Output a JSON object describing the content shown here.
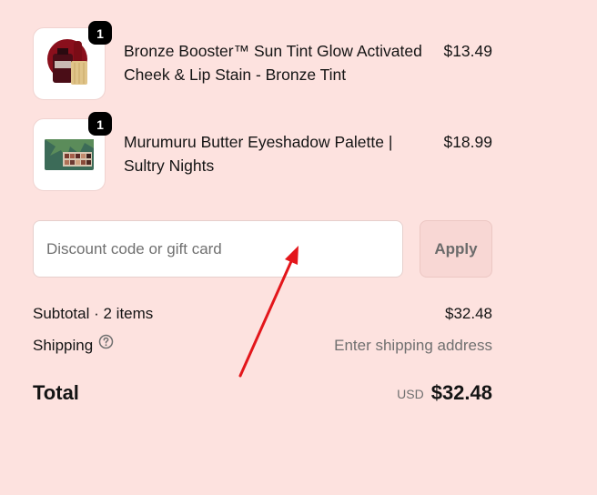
{
  "line_items": [
    {
      "name": "Bronze Booster™ Sun Tint Glow Activated Cheek & Lip Stain - Bronze Tint",
      "price": "$13.49",
      "quantity": "1",
      "image_icon": "product-image-lip-stain"
    },
    {
      "name": "Murumuru Butter Eyeshadow Palette | Sultry Nights",
      "price": "$18.99",
      "quantity": "1",
      "image_icon": "product-image-eyeshadow-palette"
    }
  ],
  "discount": {
    "placeholder": "Discount code or gift card",
    "value": "",
    "apply_label": "Apply"
  },
  "summary": {
    "subtotal_label": "Subtotal · 2 items",
    "subtotal_value": "$32.48",
    "shipping_label": "Shipping",
    "shipping_icon": "help-circle-icon",
    "shipping_value": "Enter shipping address",
    "total_label": "Total",
    "currency": "USD",
    "total_value": "$32.48"
  },
  "colors": {
    "background": "#fde2df",
    "apply_button_bg": "#f8d7d4",
    "annotation_arrow": "#e3161b",
    "badge": "#000000"
  }
}
